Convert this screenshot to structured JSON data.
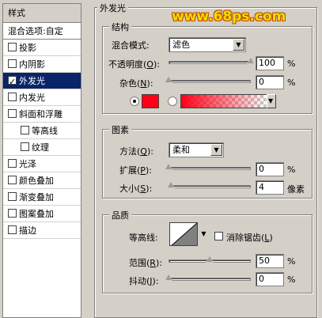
{
  "left_panel": {
    "header": "样式",
    "blend_options": "混合选项:自定",
    "items": [
      {
        "label": "投影",
        "checked": false,
        "sub": false,
        "selected": false
      },
      {
        "label": "内阴影",
        "checked": false,
        "sub": false,
        "selected": false
      },
      {
        "label": "外发光",
        "checked": true,
        "sub": false,
        "selected": true
      },
      {
        "label": "内发光",
        "checked": false,
        "sub": false,
        "selected": false
      },
      {
        "label": "斜面和浮雕",
        "checked": false,
        "sub": false,
        "selected": false
      },
      {
        "label": "等高线",
        "checked": false,
        "sub": true,
        "selected": false
      },
      {
        "label": "纹理",
        "checked": false,
        "sub": true,
        "selected": false
      },
      {
        "label": "光泽",
        "checked": false,
        "sub": false,
        "selected": false
      },
      {
        "label": "颜色叠加",
        "checked": false,
        "sub": false,
        "selected": false
      },
      {
        "label": "渐变叠加",
        "checked": false,
        "sub": false,
        "selected": false
      },
      {
        "label": "图案叠加",
        "checked": false,
        "sub": false,
        "selected": false
      },
      {
        "label": "描边",
        "checked": false,
        "sub": false,
        "selected": false
      }
    ]
  },
  "watermark": "www.68ps.com",
  "outer_title": "外发光",
  "structure": {
    "title": "结构",
    "blend_mode_label": "混合模式:",
    "blend_mode_value": "滤色",
    "opacity_label_pre": "不透明度(",
    "opacity_key": "O",
    "opacity_label_post": "):",
    "opacity_value": "100",
    "opacity_fraction": 1.0,
    "noise_label_pre": "杂色(",
    "noise_key": "N",
    "noise_label_post": "):",
    "noise_value": "0",
    "noise_fraction": 0.0,
    "percent": "%",
    "color_mode": "solid",
    "glow_color": "#ff0019"
  },
  "elements": {
    "title": "图素",
    "technique_label": "方法(Q):",
    "technique_label_pre": "方法(",
    "technique_key": "Q",
    "technique_label_post": "):",
    "technique_value": "柔和",
    "spread_label_pre": "扩展(",
    "spread_key": "P",
    "spread_label_post": "):",
    "spread_value": "0",
    "spread_fraction": 0.0,
    "size_label_pre": "大小(",
    "size_key": "S",
    "size_label_post": "):",
    "size_value": "4",
    "size_fraction": 0.03,
    "percent": "%",
    "pixels": "像素"
  },
  "quality": {
    "title": "品质",
    "contour_label": "等高线:",
    "anti_alias_label_pre": "消除锯齿(",
    "anti_alias_key": "L",
    "anti_alias_label_post": ")",
    "anti_alias_checked": false,
    "range_label_pre": "范围(",
    "range_key": "R",
    "range_label_post": "):",
    "range_value": "50",
    "range_fraction": 0.5,
    "jitter_label_pre": "抖动(",
    "jitter_key": "J",
    "jitter_label_post": "):",
    "jitter_value": "0",
    "jitter_fraction": 0.0,
    "percent": "%"
  }
}
